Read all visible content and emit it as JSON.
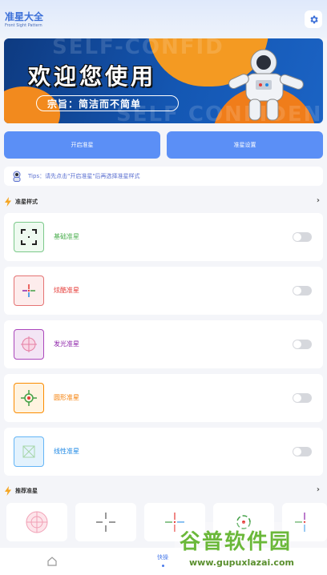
{
  "header": {
    "title": "准星大全",
    "subtitle": "Front Sight Pattern",
    "settings_icon": "gear-icon",
    "accent": "#3b6fd8"
  },
  "banner": {
    "title": "欢迎您使用",
    "subtitle": "宗旨：简洁而不简单",
    "ghost_text_1": "SELF-CONFID",
    "ghost_text_2": "SELF CONFIDENC",
    "colors": {
      "navy": "#0e3a80",
      "orange": "#f28a1e"
    }
  },
  "actions": {
    "start_label": "开启准星",
    "settings_label": "准星设置",
    "button_color": "#5b8ff6"
  },
  "tips": {
    "icon": "astronaut-icon",
    "text": "Tips：请先点击\"开启准星\"后再选择准星样式"
  },
  "styles_section": {
    "title": "准星样式",
    "icon": "lightning-icon",
    "items": [
      {
        "label": "基础准星",
        "icon": "basic-crosshair-icon",
        "color": "#4caf50",
        "enabled": false
      },
      {
        "label": "炫酷准星",
        "icon": "cool-crosshair-icon",
        "color": "#e53935",
        "enabled": false
      },
      {
        "label": "发光准星",
        "icon": "glow-crosshair-icon",
        "color": "#8e24aa",
        "enabled": false
      },
      {
        "label": "圆形准星",
        "icon": "circle-crosshair-icon",
        "color": "#f57c00",
        "enabled": false
      },
      {
        "label": "线性准星",
        "icon": "linear-crosshair-icon",
        "color": "#1e88e5",
        "enabled": false
      }
    ]
  },
  "recommend_section": {
    "title": "推荐准星",
    "icon": "lightning-icon"
  },
  "tabbar": {
    "home_icon": "home-icon",
    "quick_label": "快操"
  },
  "watermark": {
    "main": "谷普软件园",
    "url": "www.gupuxlazai.com"
  }
}
